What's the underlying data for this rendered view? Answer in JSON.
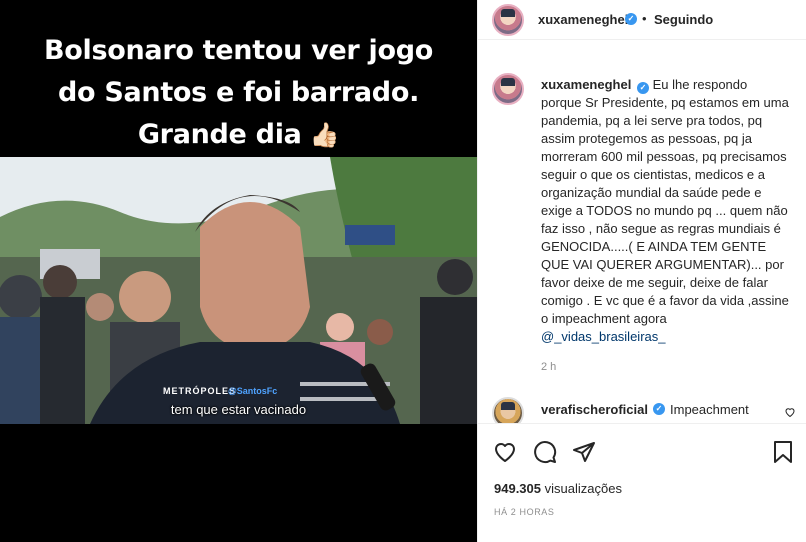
{
  "media": {
    "caption_lines": [
      "Bolsonaro tentou ver jogo",
      "do Santos e foi barrado.",
      "Grande dia"
    ],
    "caption_emoji": "👍🏻",
    "watermark": "METRÓPOLES",
    "watermark2": "@SantosFc",
    "subtitle": "tem que estar vacinado"
  },
  "header": {
    "username": "xuxameneghel",
    "verified_mark": "✓",
    "separator": "•",
    "follow_status": "Seguindo",
    "more_label": "…"
  },
  "comment": {
    "username": "xuxameneghel",
    "text": " Eu lhe respondo porque Sr Presidente, pq estamos em uma pandemia, pq a lei serve pra todos, pq assim protegemos as pessoas, pq ja morreram 600 mil pessoas, pq precisamos seguir o que os cientistas, medicos e a organização mundial da saúde pede e exige a TODOS no mundo pq ... quem não faz isso , não segue as regras mundiais é GENOCIDA.....( E AINDA TEM GENTE QUE VAI QUERER ARGUMENTAR)... por favor deixe de me seguir, deixe de falar comigo . E vc que é a favor da vida ,assine o impeachment agora ",
    "mention": "@_vidas_brasileiras_",
    "time": "2 h"
  },
  "reply": {
    "username": "verafischeroficial",
    "text": "Impeachment"
  },
  "actions": {
    "views_count": "949.305",
    "views_label": "visualizações",
    "ago": "HÁ 2 HORAS"
  }
}
